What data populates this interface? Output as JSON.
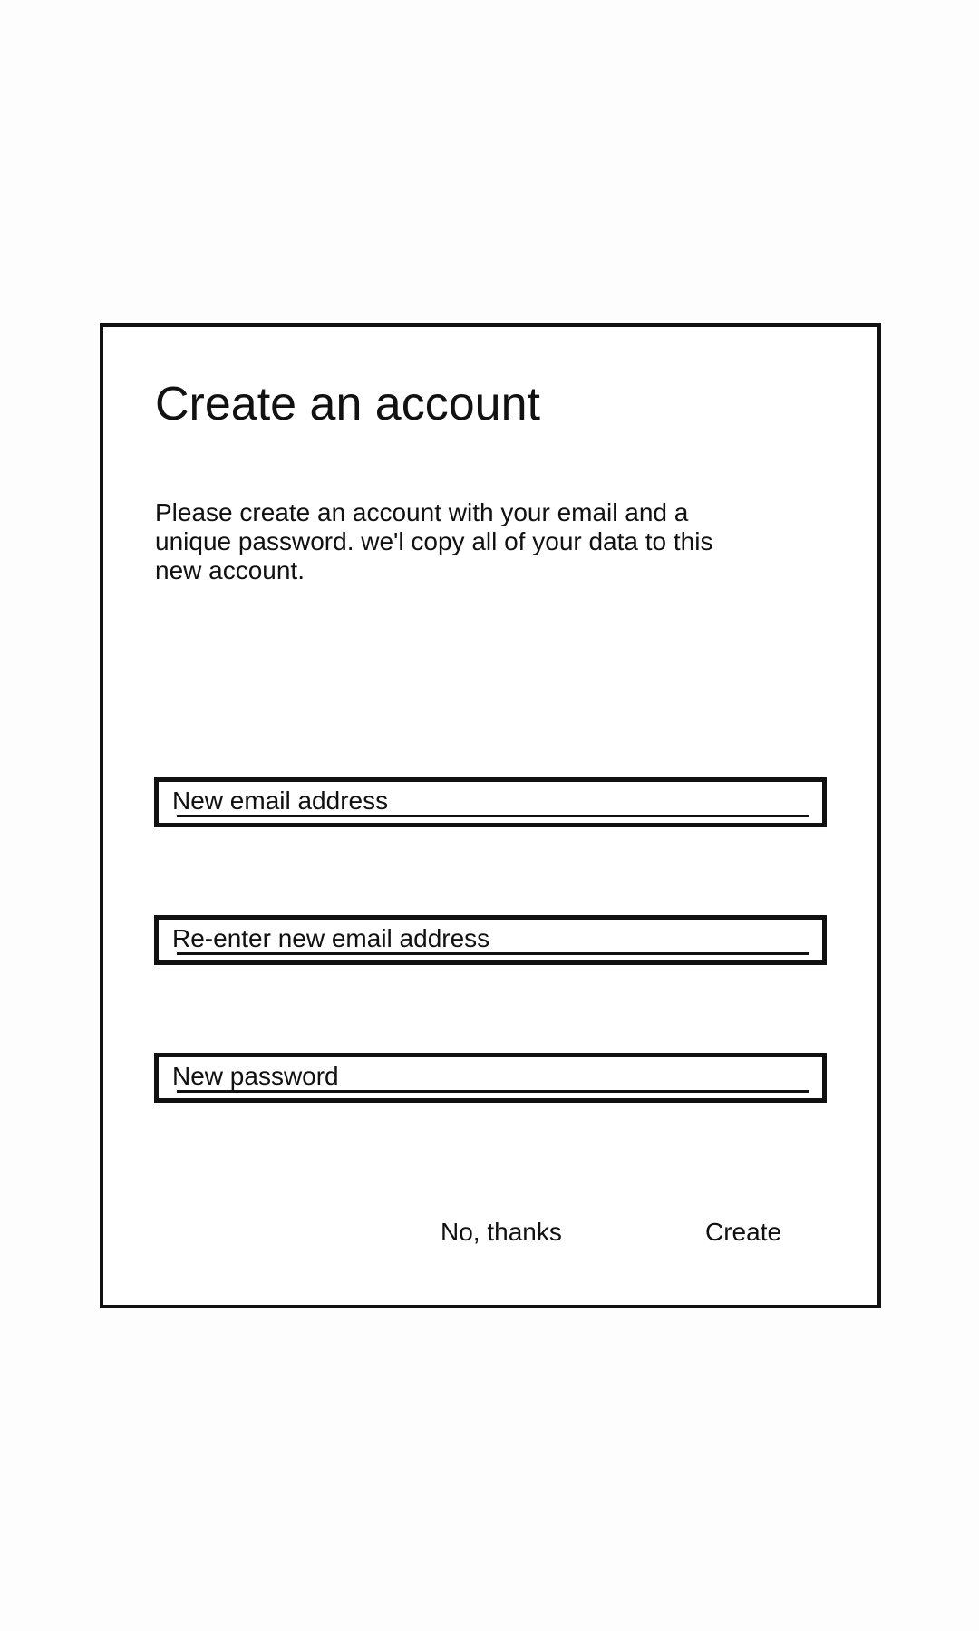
{
  "dialog": {
    "title": "Create an account",
    "description": "Please create an account with your email and a unique password. we'l copy all of your data to this new account.",
    "fields": [
      {
        "placeholder": "New email address"
      },
      {
        "placeholder": "Re-enter new email address"
      },
      {
        "placeholder": "New password"
      }
    ],
    "actions": {
      "cancel_label": "No, thanks",
      "create_label": "Create"
    }
  }
}
